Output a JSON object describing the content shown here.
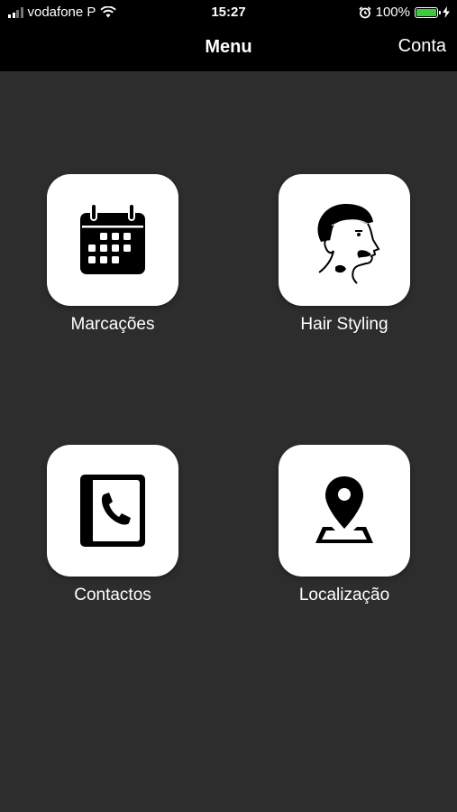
{
  "status_bar": {
    "carrier": "vodafone P",
    "time": "15:27",
    "battery_percent": "100%",
    "battery_level": 1.0,
    "battery_color": "#3ccb3c"
  },
  "nav": {
    "title": "Menu",
    "account_label": "Conta"
  },
  "menu": {
    "items": [
      {
        "label": "Marcações",
        "icon": "calendar-icon"
      },
      {
        "label": "Hair Styling",
        "icon": "barber-portrait-icon"
      },
      {
        "label": "Contactos",
        "icon": "phonebook-icon"
      },
      {
        "label": "Localização",
        "icon": "map-pin-icon"
      }
    ]
  },
  "colors": {
    "background": "#2d2d2d",
    "bar": "#000000",
    "tile": "#ffffff"
  }
}
